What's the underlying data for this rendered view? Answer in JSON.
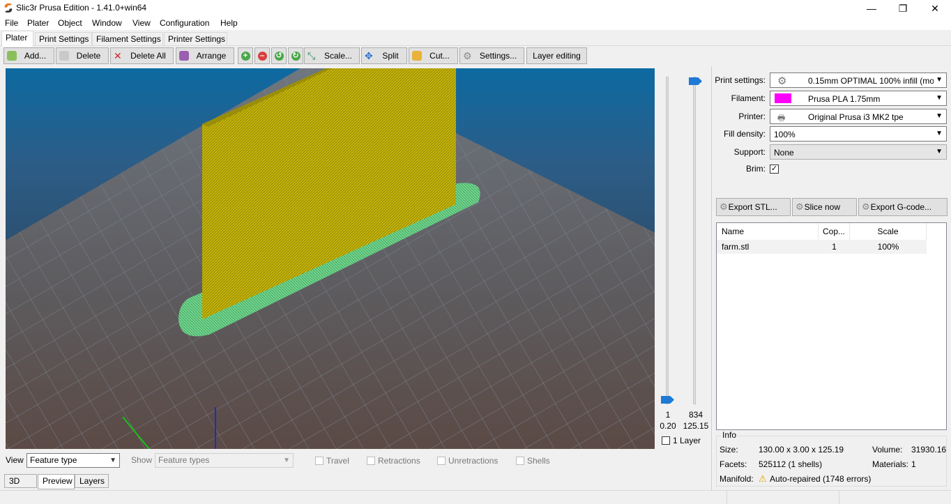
{
  "window": {
    "title": "Slic3r Prusa Edition - 1.41.0+win64",
    "minimize": "—",
    "maximize": "❐",
    "close": "✕"
  },
  "menu": [
    "File",
    "Plater",
    "Object",
    "Window",
    "View",
    "Configuration",
    "Help"
  ],
  "tabs": [
    "Plater",
    "Print Settings",
    "Filament Settings",
    "Printer Settings"
  ],
  "toolbar": {
    "add": "Add...",
    "delete": "Delete",
    "delete_all": "Delete All",
    "arrange": "Arrange",
    "scale": "Scale...",
    "split": "Split",
    "cut": "Cut...",
    "settings": "Settings...",
    "layer_editing": "Layer editing"
  },
  "layer_slider": {
    "min_layer": "1",
    "min_height": "0.20",
    "max_layer": "834",
    "max_height": "125.15",
    "one_layer": "1 Layer"
  },
  "preview_controls": {
    "view_label": "View",
    "view_value": "Feature type",
    "show_label": "Show",
    "show_value": "Feature types",
    "travel": "Travel",
    "retractions": "Retractions",
    "unretractions": "Unretractions",
    "shells": "Shells"
  },
  "bottom_tabs": [
    "3D",
    "Preview",
    "Layers"
  ],
  "settings": {
    "print_label": "Print settings:",
    "print_value": "0.15mm OPTIMAL 100% infill (mod",
    "filament_label": "Filament:",
    "filament_value": "Prusa PLA 1.75mm",
    "filament_color": "#ff00ff",
    "printer_label": "Printer:",
    "printer_value": "Original Prusa i3 MK2 tpe",
    "fill_label": "Fill density:",
    "fill_value": "100%",
    "support_label": "Support:",
    "support_value": "None",
    "brim_label": "Brim:",
    "brim_checked": true
  },
  "actions": {
    "export_stl": "Export STL...",
    "slice_now": "Slice now",
    "export_gcode": "Export G-code..."
  },
  "object_list": {
    "columns": [
      "Name",
      "Cop...",
      "Scale"
    ],
    "rows": [
      {
        "name": "farm.stl",
        "copies": "1",
        "scale": "100%"
      }
    ]
  },
  "info": {
    "title": "Info",
    "size_label": "Size:",
    "size_value": "130.00 x 3.00 x 125.19",
    "volume_label": "Volume:",
    "volume_value": "31930.16",
    "facets_label": "Facets:",
    "facets_value": "525112 (1 shells)",
    "materials_label": "Materials:",
    "materials_value": "1",
    "manifold_label": "Manifold:",
    "manifold_value": "Auto-repaired (1748 errors)"
  }
}
